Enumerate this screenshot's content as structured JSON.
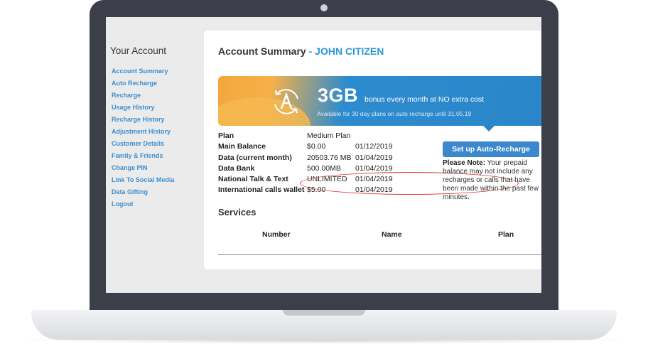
{
  "sidebar": {
    "title": "Your Account",
    "items": [
      {
        "label": "Account Summary"
      },
      {
        "label": "Auto Recharge"
      },
      {
        "label": "Recharge"
      },
      {
        "label": "Usage History"
      },
      {
        "label": "Recharge History"
      },
      {
        "label": "Adjustment History"
      },
      {
        "label": "Customer Details"
      },
      {
        "label": "Family & Friends"
      },
      {
        "label": "Change PIN"
      },
      {
        "label": "Link To Social Media"
      },
      {
        "label": "Data Gifting"
      },
      {
        "label": "Logout"
      }
    ]
  },
  "main": {
    "title": "Account Summary",
    "title_separator": " - ",
    "customer_name": "JOHN CITIZEN",
    "banner": {
      "headline": "3GB",
      "text": "bonus every month at NO extra cost",
      "subtext": "Available for 30 day plans on auto recharge until 31.05.19"
    },
    "account_rows": [
      {
        "label": "Plan",
        "value": "Medium Plan",
        "date": ""
      },
      {
        "label": "Main Balance",
        "value": "$0.00",
        "date": "01/12/2019"
      },
      {
        "label": "Data (current month)",
        "value": "20503.76 MB",
        "date": "01/04/2019"
      },
      {
        "label": "Data Bank",
        "value": "500.00MB",
        "date": "01/04/2019"
      },
      {
        "label": "National Talk & Text",
        "value": "UNLIMITED",
        "date": "01/04/2019"
      },
      {
        "label": "International calls wallet",
        "value": "$5.00",
        "date": "01/04/2019"
      }
    ],
    "auto_recharge_button": "Set up Auto-Recharge",
    "note_label": "Please Note:",
    "note_text": "Your prepaid balance may not include any recharges or calls that have been made within the past few minutes.",
    "services": {
      "title": "Services",
      "columns": [
        "Number",
        "Name",
        "Plan"
      ]
    }
  },
  "colors": {
    "link_blue": "#3d8fd0",
    "name_blue": "#2b97d6",
    "button_blue": "#3b89cc",
    "highlight_red": "#e0393a"
  }
}
